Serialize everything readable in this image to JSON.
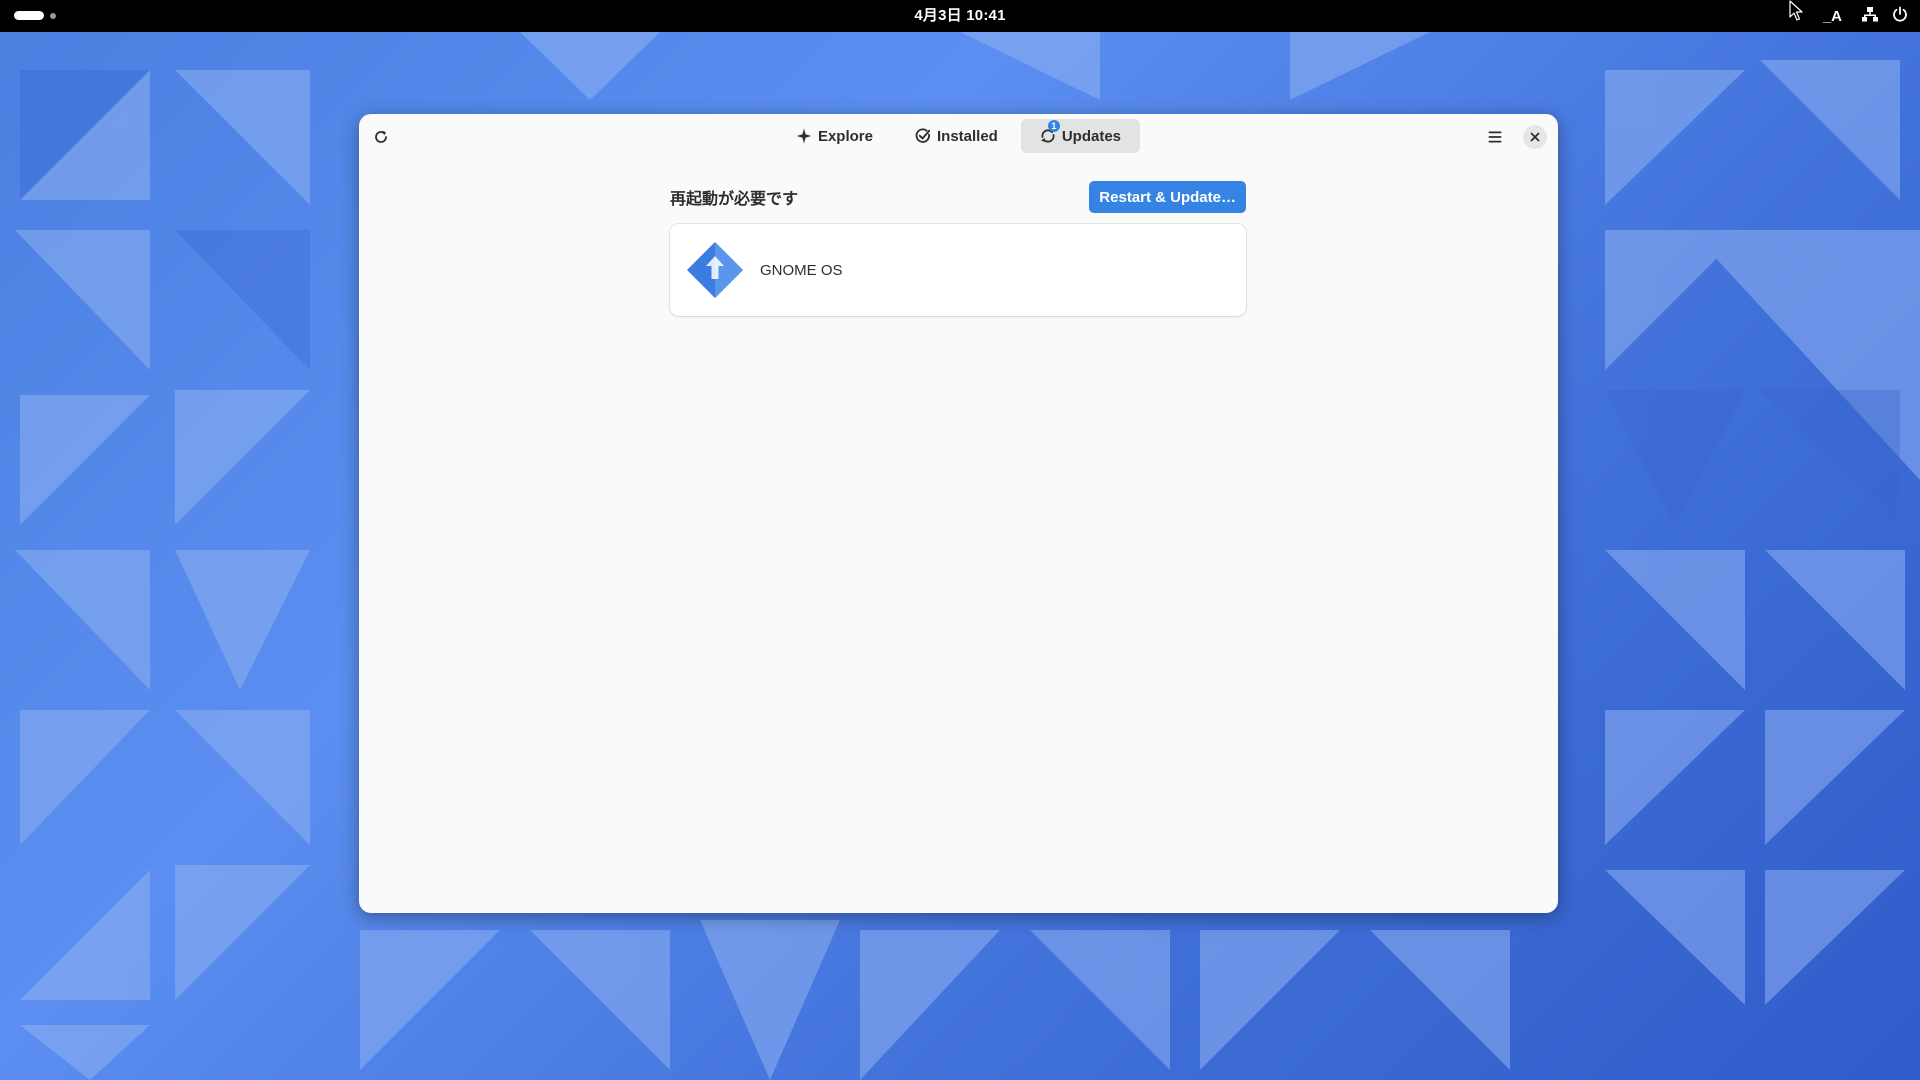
{
  "topbar": {
    "clock": "4月3日 10:41",
    "input_method": "_A",
    "icons": [
      "activities-indicator",
      "network-wired-icon",
      "power-icon"
    ]
  },
  "window": {
    "tabs": [
      {
        "label": "Explore",
        "icon": "explore-sparkle-icon"
      },
      {
        "label": "Installed",
        "icon": "check-circle-icon"
      },
      {
        "label": "Updates",
        "icon": "update-arrows-icon",
        "badge": "1",
        "active": true
      }
    ],
    "refresh_icon": "refresh-icon",
    "menu_icon": "hamburger-menu-icon",
    "close_icon": "close-icon"
  },
  "updates": {
    "section_title": "再起動が必要です",
    "restart_button": "Restart & Update…",
    "items": [
      {
        "name": "GNOME OS",
        "icon": "os-update-diamond-icon"
      }
    ]
  },
  "colors": {
    "accent": "#3584e4",
    "window_bg": "#fafafa",
    "topbar_bg": "#000000"
  }
}
